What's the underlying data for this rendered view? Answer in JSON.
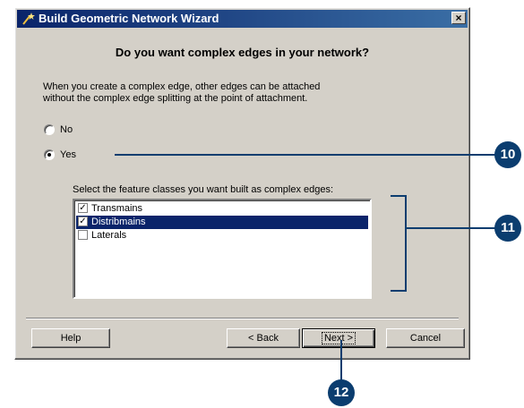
{
  "window": {
    "title": "Build Geometric Network Wizard",
    "close_glyph": "×"
  },
  "heading": "Do you want complex edges in your network?",
  "description": {
    "line1": "When you create a complex edge, other edges can be attached",
    "line2": "without the complex edge splitting at the point of attachment."
  },
  "options": {
    "no_label": "No",
    "yes_label": "Yes",
    "selected": "Yes"
  },
  "feature_select": {
    "label": "Select the feature classes you want built as complex edges:",
    "items": [
      {
        "label": "Transmains",
        "checked": true,
        "selected": false
      },
      {
        "label": "Distribmains",
        "checked": true,
        "selected": true
      },
      {
        "label": "Laterals",
        "checked": false,
        "selected": false
      }
    ]
  },
  "buttons": {
    "help": "Help",
    "back": "< Back",
    "next": "Next >",
    "cancel": "Cancel"
  },
  "callouts": {
    "c10": "10",
    "c11": "11",
    "c12": "12"
  },
  "colors": {
    "callout": "#0b3d6f",
    "titlebar": "#0a246a",
    "dialog": "#d4d0c8"
  }
}
